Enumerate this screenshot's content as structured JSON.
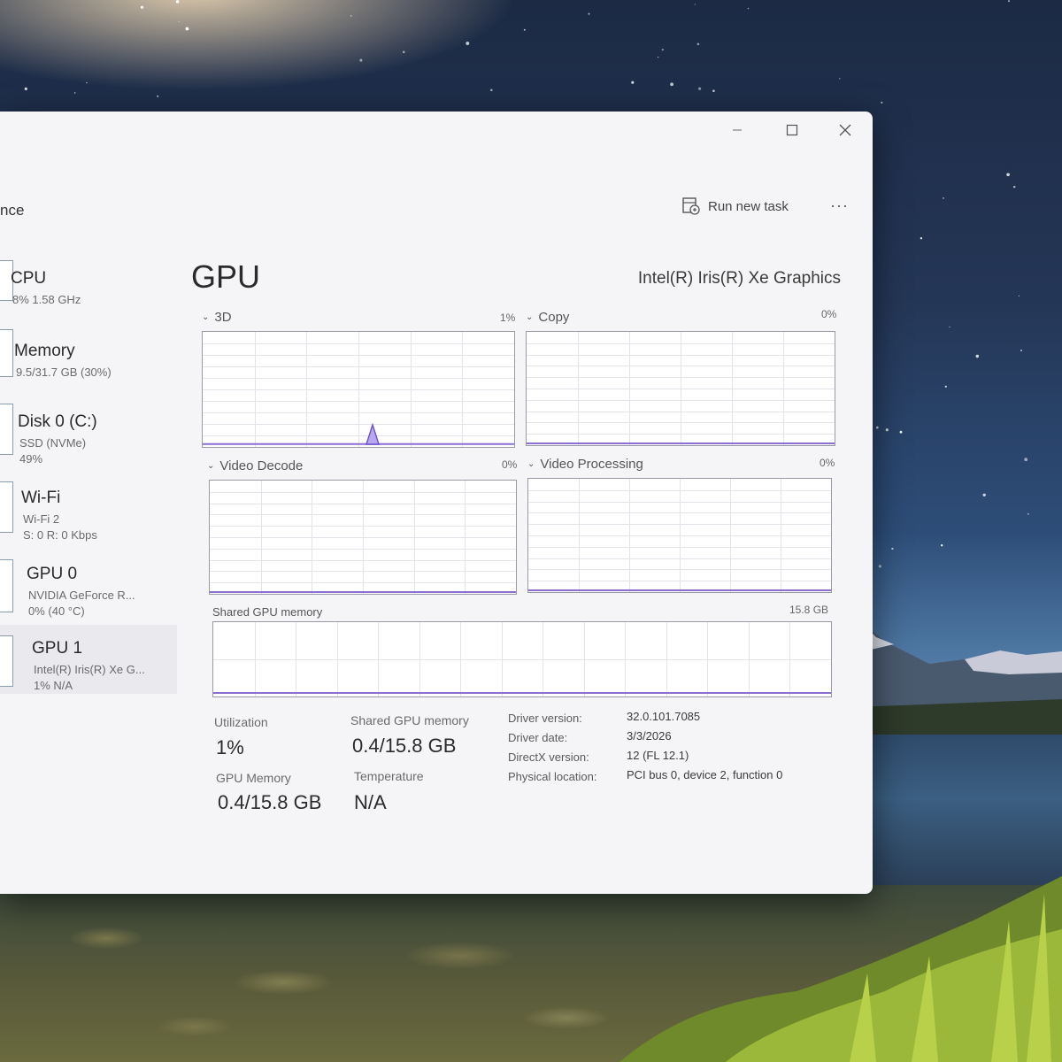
{
  "window": {
    "section_name": "nce",
    "run_new_task": "Run new task",
    "more": "···"
  },
  "sidebar": {
    "items": [
      {
        "name": "CPU",
        "line1": "8% 1.58 GHz",
        "line2": "",
        "line3": ""
      },
      {
        "name": "Memory",
        "line1": "9.5/31.7 GB (30%)",
        "line2": "",
        "line3": ""
      },
      {
        "name": "Disk 0 (C:)",
        "line1": "SSD (NVMe)",
        "line2": "49%",
        "line3": ""
      },
      {
        "name": "Wi-Fi",
        "line1": "Wi-Fi 2",
        "line2": "S: 0 R: 0 Kbps",
        "line3": ""
      },
      {
        "name": "GPU 0",
        "line1": "NVIDIA GeForce R...",
        "line2": "0% (40 °C)",
        "line3": ""
      },
      {
        "name": "GPU 1",
        "line1": "Intel(R) Iris(R) Xe G...",
        "line2": "1% N/A",
        "line3": ""
      }
    ]
  },
  "main": {
    "title": "GPU",
    "adapter": "Intel(R) Iris(R) Xe Graphics",
    "graphs": [
      {
        "title": "3D",
        "pct": "1%",
        "fill": 0.01
      },
      {
        "title": "Copy",
        "pct": "0%",
        "fill": 0
      },
      {
        "title": "Video Decode",
        "pct": "0%",
        "fill": 0
      },
      {
        "title": "Video Processing",
        "pct": "0%",
        "fill": 0
      }
    ],
    "shared_graph": {
      "title": "Shared GPU memory",
      "max": "15.8 GB",
      "fill": 0.025
    },
    "stats": {
      "utilization_label": "Utilization",
      "utilization_value": "1%",
      "shared_label": "Shared GPU memory",
      "shared_value": "0.4/15.8 GB",
      "gpu_memory_label": "GPU Memory",
      "gpu_memory_value": "0.4/15.8 GB",
      "temperature_label": "Temperature",
      "temperature_value": "N/A"
    },
    "info": {
      "driver_version_label": "Driver version:",
      "driver_version": "32.0.101.7085",
      "driver_date_label": "Driver date:",
      "driver_date": "3/3/2026",
      "directx_label": "DirectX version:",
      "directx": "12 (FL 12.1)",
      "location_label": "Physical location:",
      "location": "PCI bus 0, device 2, function 0"
    }
  },
  "colors": {
    "graph_line": "#8a6fd1",
    "grid": "#e3e3ea",
    "accent": "#7b5fc9"
  }
}
